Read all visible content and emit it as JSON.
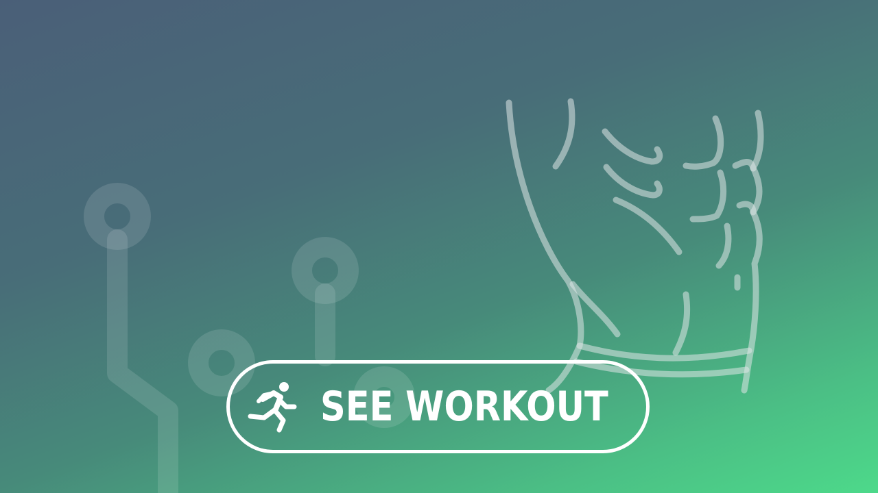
{
  "banner": {
    "background_colors": [
      "#4a5f78",
      "#4dd98a"
    ],
    "decoration_icons": [
      "circuit-icon",
      "abdominal-muscles-icon"
    ]
  },
  "cta": {
    "label": "SEE WORKOUT",
    "icon": "running-person-icon",
    "border_color": "#ffffff"
  }
}
